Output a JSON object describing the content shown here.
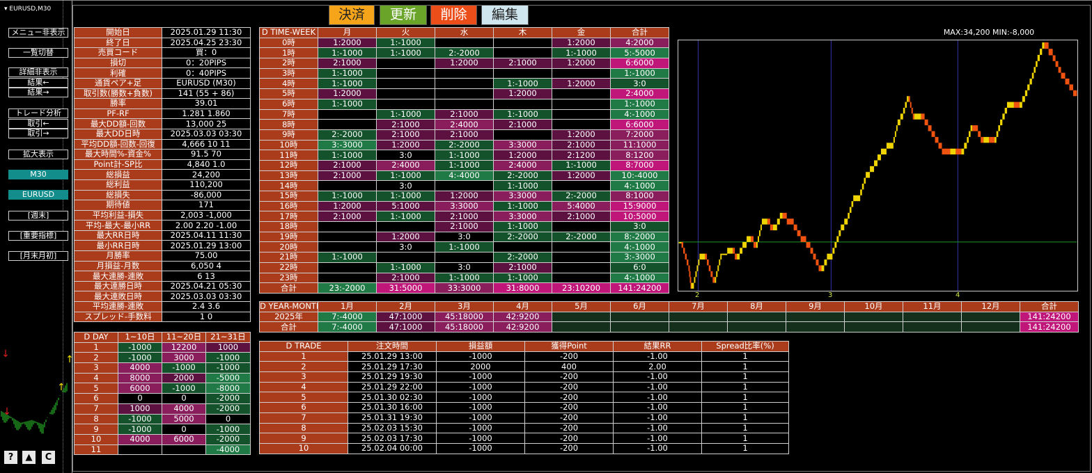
{
  "window": {
    "title": "EURUSD,M30"
  },
  "top_buttons": [
    "決済",
    "更新",
    "削除",
    "編集"
  ],
  "left_buttons": [
    "メニュー非表示",
    "一覧切替",
    "詳細非表示",
    "結果←",
    "結果→",
    "トレード分析",
    "取引←",
    "取引→",
    "拡大表示",
    "M30",
    "EURUSD",
    "[週末]",
    "[重要指標]",
    "[月末月初]"
  ],
  "bottom_icons": [
    "?",
    "▲",
    "C"
  ],
  "colors": {
    "label": "#aa3c1c",
    "pos": "#13522a",
    "pos2": "#1f7a46",
    "neg": "#5c1140",
    "neg2": "#8a1d5c",
    "cyan": "#138c8c",
    "sum": "#c0167a"
  },
  "stats": [
    [
      "開始日",
      "2025.01.29 11:30"
    ],
    [
      "終了日",
      "2025.04.25 23:30"
    ],
    [
      "売買コード",
      "買：0"
    ],
    [
      "損切",
      "0：20PIPS"
    ],
    [
      "利確",
      "0：40PIPS"
    ],
    [
      "通貨ペア+足",
      "EURUSD (M30)"
    ],
    [
      "取引数(勝数+負数)",
      "141 (55 + 86)"
    ],
    [
      "勝率",
      "39.01"
    ],
    [
      "PF-RF",
      "1.281  1.860"
    ],
    [
      "最大DD額-回数",
      "13,000  25"
    ],
    [
      "最大DD日時",
      "2025.03.03 03:30"
    ],
    [
      "平均DD額-回数-回復",
      "4,666  10  11"
    ],
    [
      "最大時間%-資金%",
      "91.5  70"
    ],
    [
      "Point計-SP比",
      "4,840  1.0"
    ],
    [
      "総損益",
      "24,200"
    ],
    [
      "総利益",
      "110,200"
    ],
    [
      "総損失",
      "-86,000"
    ],
    [
      "期待値",
      "171"
    ],
    [
      "平均利益-損失",
      "2,003  -1,000"
    ],
    [
      "平均-最大-最小RR",
      "2.00  2.20  -1.00"
    ],
    [
      "最大RR日時",
      "2025.04.11 11:30"
    ],
    [
      "最小RR日時",
      "2025.01.29 13:00"
    ],
    [
      "月勝率",
      "75.00"
    ],
    [
      "月損益-月数",
      "6,050  4"
    ],
    [
      "最大連勝-連敗",
      "6  13"
    ],
    [
      "最大連勝日時",
      "2025.04.21 05:30"
    ],
    [
      "最大連敗日時",
      "2025.03.03 03:30"
    ],
    [
      "平均連勝-連敗",
      "2.4  3.6"
    ],
    [
      "スプレッド-手数料",
      "1  0"
    ]
  ],
  "time_week": {
    "header": [
      "D TIME-WEEK",
      "月",
      "火",
      "水",
      "木",
      "金",
      "合計"
    ],
    "rows": [
      [
        "0時",
        "1:2000",
        "1:-1000",
        "",
        "",
        "1:2000",
        "4:2000"
      ],
      [
        "1時",
        "1:-1000",
        "1:-1000",
        "2:-2000",
        "",
        "1:-1000",
        "5:-5000"
      ],
      [
        "2時",
        "2:1000",
        "",
        "1:2000",
        "2:1000",
        "1:2000",
        "6:6000"
      ],
      [
        "3時",
        "1:-1000",
        "",
        "",
        "",
        "",
        "1:-1000"
      ],
      [
        "4時",
        "1:-1000",
        "",
        "",
        "1:-1000",
        "1:2000",
        "3:0"
      ],
      [
        "5時",
        "1:2000",
        "",
        "",
        "1:2000",
        "",
        "2:4000"
      ],
      [
        "6時",
        "1:-1000",
        "",
        "",
        "",
        "",
        "1:-1000"
      ],
      [
        "7時",
        "",
        "1:-1000",
        "2:1000",
        "1:-1000",
        "",
        "4:-1000"
      ],
      [
        "8時",
        "",
        "2:1000",
        "2:4000",
        "2:1000",
        "",
        "6:6000"
      ],
      [
        "9時",
        "2:-2000",
        "2:1000",
        "2:1000",
        "",
        "1:2000",
        "7:2000"
      ],
      [
        "10時",
        "3:-3000",
        "1:2000",
        "2:-2000",
        "3:3000",
        "2:1000",
        "11:1000"
      ],
      [
        "11時",
        "1:-1000",
        "3:0",
        "1:-1000",
        "1:2000",
        "2:1200",
        "8:1200"
      ],
      [
        "12時",
        "2:1000",
        "2:4000",
        "1:-1000",
        "2:4000",
        "1:-1000",
        "8:7000"
      ],
      [
        "13時",
        "2:1000",
        "1:-1000",
        "4:-4000",
        "2:-2000",
        "1:2000",
        "10:-4000"
      ],
      [
        "14時",
        "",
        "3:0",
        "",
        "1:-1000",
        "",
        "4:-1000"
      ],
      [
        "15時",
        "1:-1000",
        "1:-1000",
        "1:2000",
        "3:3000",
        "2:-2000",
        "8:1000"
      ],
      [
        "16時",
        "1:2000",
        "5:1000",
        "3:3000",
        "1:-1000",
        "5:4000",
        "15:9000"
      ],
      [
        "17時",
        "2:1000",
        "1:-1000",
        "2:1000",
        "3:3000",
        "2:1000",
        "10:5000"
      ],
      [
        "18時",
        "",
        "",
        "2:1000",
        "1:-1000",
        "",
        "3:0"
      ],
      [
        "19時",
        "",
        "1:2000",
        "3:0",
        "2:-2000",
        "2:-2000",
        "8:-2000"
      ],
      [
        "20時",
        "",
        "3:0",
        "1:-1000",
        "",
        "",
        "4:-1000"
      ],
      [
        "21時",
        "1:-1000",
        "",
        "",
        "2:-2000",
        "",
        "3:-3000"
      ],
      [
        "22時",
        "",
        "1:-1000",
        "3:0",
        "2:1000",
        "",
        "6:0"
      ],
      [
        "23時",
        "",
        "2:1000",
        "1:-1000",
        "1:-1000",
        "",
        "4:-1000"
      ],
      [
        "合計",
        "23:-2000",
        "31:5000",
        "33:3000",
        "31:8000",
        "23:10200",
        "141:24200"
      ]
    ]
  },
  "year_month": {
    "header": [
      "D YEAR-MONTH",
      "1月",
      "2月",
      "3月",
      "4月",
      "5月",
      "6月",
      "7月",
      "8月",
      "9月",
      "10月",
      "11月",
      "12月",
      "合計"
    ],
    "rows": [
      [
        "2025年",
        "7:-4000",
        "47:1000",
        "45:18000",
        "42:9200",
        "",
        "",
        "",
        "",
        "",
        "",
        "",
        "",
        "141:24200"
      ],
      [
        "合計",
        "7:-4000",
        "47:1000",
        "45:18000",
        "42:9200",
        "",
        "",
        "",
        "",
        "",
        "",
        "",
        "",
        "141:24200"
      ]
    ]
  },
  "day": {
    "header": [
      "D DAY",
      "1~10日",
      "11~20日",
      "21~31日"
    ],
    "rows": [
      [
        "1",
        "-1000",
        "12200",
        "1000"
      ],
      [
        "2",
        "-1000",
        "3000",
        "-1000"
      ],
      [
        "3",
        "4000",
        "-1000",
        "-1000"
      ],
      [
        "4",
        "8000",
        "2000",
        "-5000"
      ],
      [
        "5",
        "6000",
        "-1000",
        "-8000"
      ],
      [
        "6",
        "0",
        "0",
        "-2000"
      ],
      [
        "7",
        "1000",
        "4000",
        "-2000"
      ],
      [
        "8",
        "-1000",
        "5000",
        "0"
      ],
      [
        "9",
        "-1000",
        "0",
        "-1000"
      ],
      [
        "10",
        "4000",
        "6000",
        "-2000"
      ],
      [
        "11",
        "",
        "",
        "-4000"
      ]
    ]
  },
  "trades": {
    "header": [
      "D TRADE",
      "注文時間",
      "損益額",
      "獲得Point",
      "結果RR",
      "Spread比率(%)"
    ],
    "rows": [
      [
        "1",
        "25.01.29 13:00",
        "-1000",
        "-200",
        "-1.00",
        "1"
      ],
      [
        "2",
        "25.01.29 17:30",
        "2000",
        "400",
        "2.00",
        "1"
      ],
      [
        "3",
        "25.01.29 19:30",
        "-1000",
        "-200",
        "-1.00",
        "1"
      ],
      [
        "4",
        "25.01.29 22:00",
        "-1000",
        "-200",
        "-1.00",
        "1"
      ],
      [
        "5",
        "25.01.30 02:30",
        "-1000",
        "-200",
        "-1.00",
        "1"
      ],
      [
        "6",
        "25.01.30 16:00",
        "-1000",
        "-200",
        "-1.00",
        "1"
      ],
      [
        "7",
        "25.01.31 19:30",
        "-1000",
        "-200",
        "-1.00",
        "1"
      ],
      [
        "8",
        "25.02.03 15:30",
        "-1000",
        "-200",
        "-1.00",
        "1"
      ],
      [
        "9",
        "25.02.03 17:30",
        "-1000",
        "-200",
        "-1.00",
        "1"
      ],
      [
        "10",
        "25.02.04 00:00",
        "-1000",
        "-200",
        "-1.00",
        "1"
      ]
    ]
  },
  "chart": {
    "max_min": "MAX:34,200   MIN:-8,000",
    "x_labels": [
      "2",
      "3",
      "4"
    ],
    "ylim": [
      -8000,
      34200
    ]
  }
}
